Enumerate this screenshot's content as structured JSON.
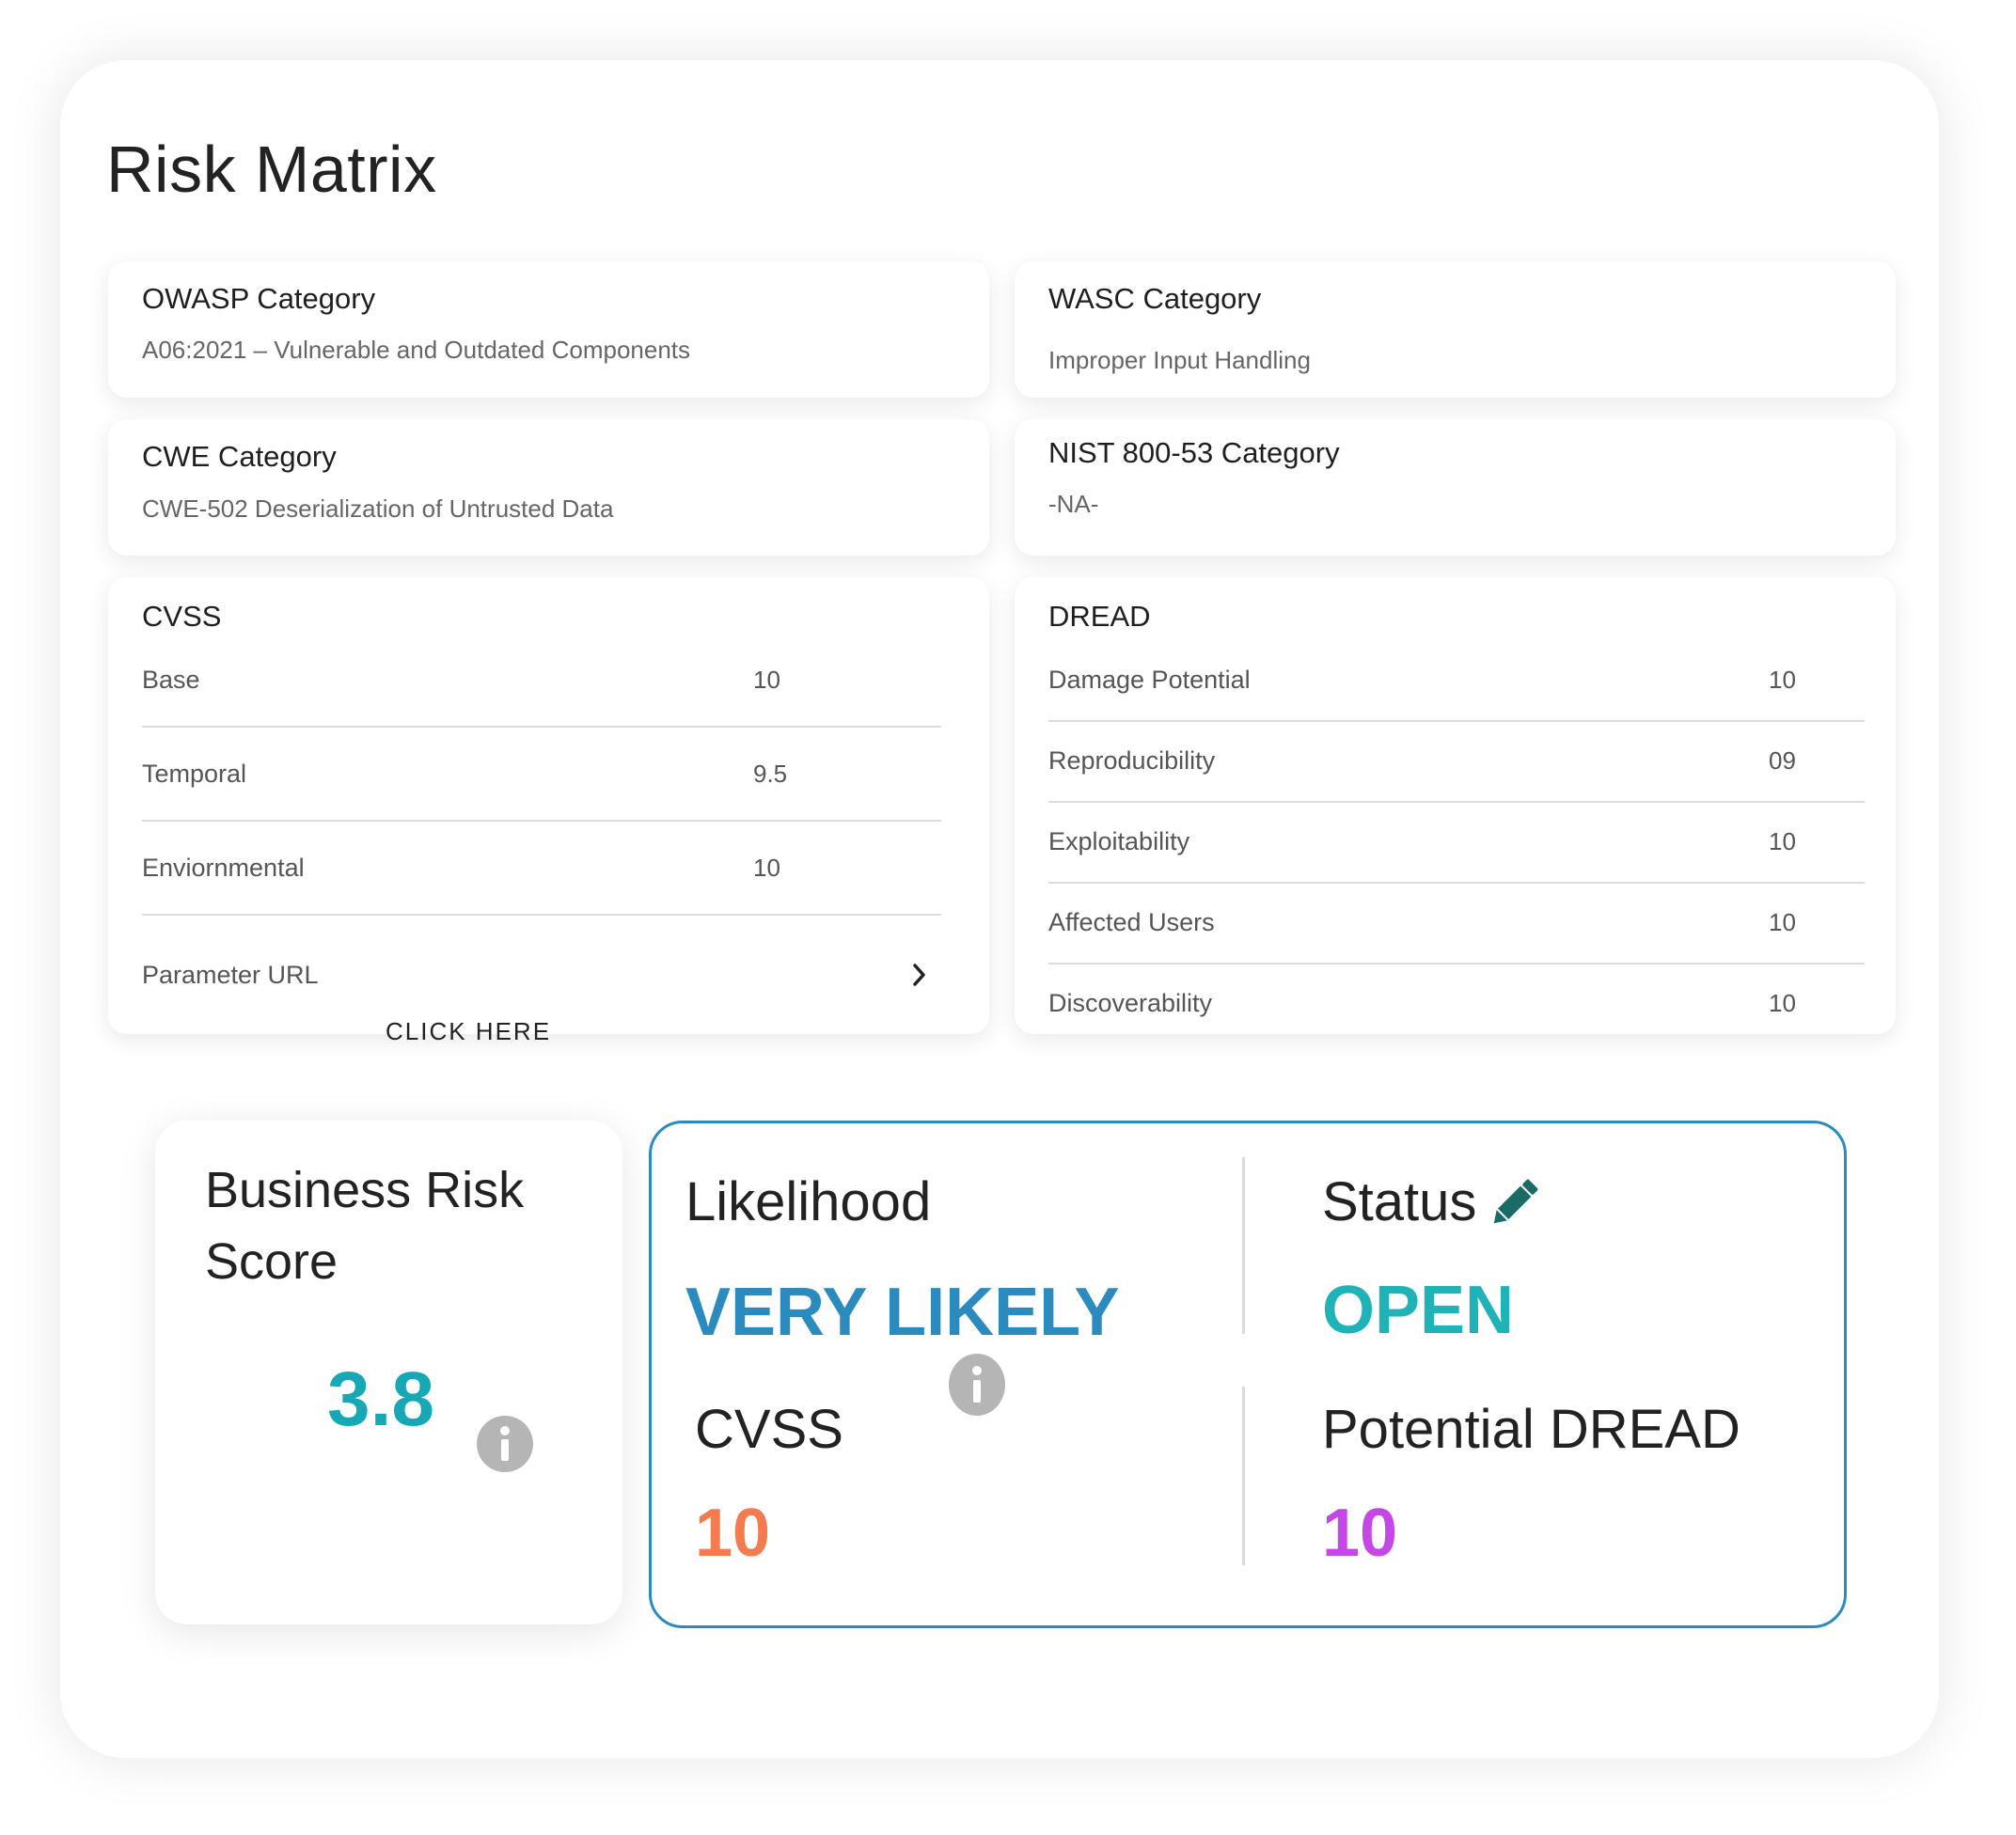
{
  "title": "Risk Matrix",
  "owasp": {
    "label": "OWASP Category",
    "value": "A06:2021 – Vulnerable and Outdated Components"
  },
  "wasc": {
    "label": "WASC Category",
    "value": "Improper Input Handling"
  },
  "cwe": {
    "label": "CWE Category",
    "value": "CWE-502 Deserialization of Untrusted Data"
  },
  "nist": {
    "label": "NIST 800-53 Category",
    "value": "-NA-"
  },
  "cvss": {
    "label": "CVSS",
    "rows": [
      {
        "label": "Base",
        "value": "10"
      },
      {
        "label": "Temporal",
        "value": "9.5"
      },
      {
        "label": "Enviornmental",
        "value": "10"
      }
    ],
    "parameter_url_label": "Parameter URL",
    "click_here": "CLICK HERE"
  },
  "dread": {
    "label": "DREAD",
    "rows": [
      {
        "label": "Damage Potential",
        "value": "10"
      },
      {
        "label": "Reproducibility",
        "value": "09"
      },
      {
        "label": "Exploitability",
        "value": "10"
      },
      {
        "label": "Affected Users",
        "value": "10"
      },
      {
        "label": "Discoverability",
        "value": "10"
      }
    ]
  },
  "business_risk": {
    "label": "Business Risk Score",
    "score": "3.8"
  },
  "likelihood": {
    "label": "Likelihood",
    "value": "VERY LIKELY"
  },
  "status": {
    "label": "Status",
    "value": "OPEN"
  },
  "cvss_summary": {
    "label": "CVSS",
    "value": "10"
  },
  "potential_dread": {
    "label": "Potential DREAD",
    "value": "10"
  },
  "colors": {
    "likelihood": "#2b8bbf",
    "status": "#1fb3b8",
    "cvss": "#f47b50",
    "dread": "#c447e6",
    "score": "#16a9b5",
    "edit_icon": "#1a6b66",
    "border": "#2b8bbf"
  },
  "icons": {
    "edit": "pencil-icon",
    "info": "info-icon",
    "chevron": "chevron-right-icon"
  }
}
